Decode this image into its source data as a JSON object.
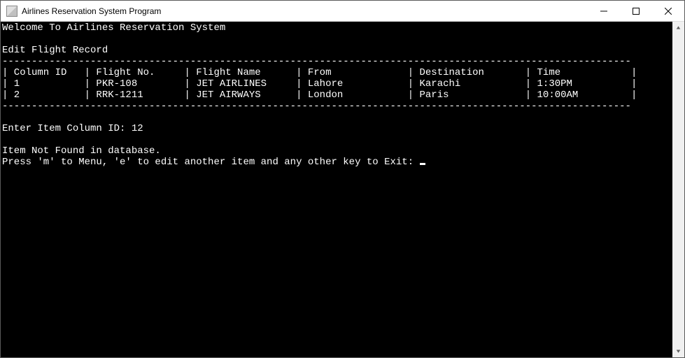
{
  "titlebar": {
    "title": "Airlines Reservation System Program"
  },
  "console": {
    "welcome": "Welcome To Airlines Reservation System",
    "section": "Edit Flight Record",
    "divider": "-----------------------------------------------------------------------------------------------------------",
    "headers": {
      "col_id": "Column ID",
      "flight_no": "Flight No.",
      "flight_name": "Flight Name",
      "from": "From",
      "destination": "Destination",
      "time": "Time"
    },
    "rows": [
      {
        "col_id": "1",
        "flight_no": "PKR-108",
        "flight_name": "JET AIRLINES",
        "from": "Lahore",
        "destination": "Karachi",
        "time": "1:30PM"
      },
      {
        "col_id": "2",
        "flight_no": "RRK-1211",
        "flight_name": "JET AIRWAYS",
        "from": "London",
        "destination": "Paris",
        "time": "10:00AM"
      }
    ],
    "prompt_label": "Enter Item Column ID: ",
    "prompt_value": "12",
    "not_found": "Item Not Found in database.",
    "exit_prompt": "Press 'm' to Menu, 'e' to edit another item and any other key to Exit: "
  }
}
